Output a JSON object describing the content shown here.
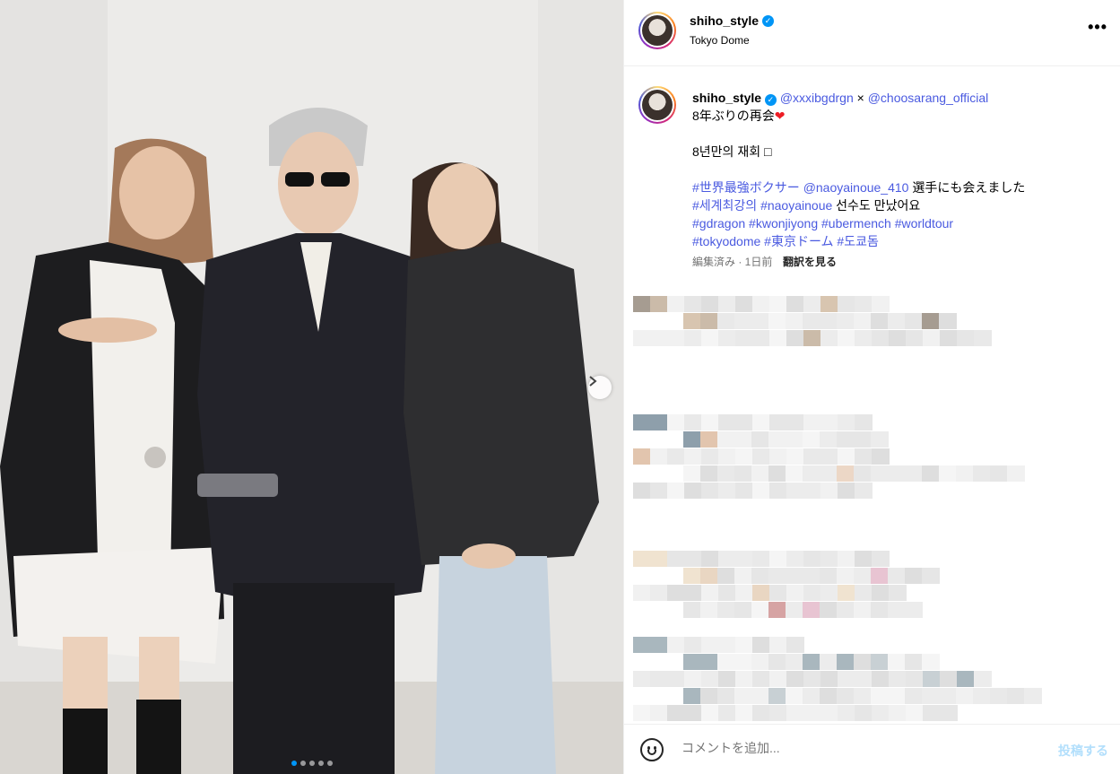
{
  "post": {
    "username": "shiho_style",
    "location": "Tokyo Dome",
    "more_label": "•••",
    "carousel": {
      "slide_count": 5,
      "active_index": 0
    }
  },
  "caption": {
    "username": "shiho_style",
    "mention_1": "@xxxibgdrgn",
    "separator": " × ",
    "mention_2": "@choosarang_official",
    "line_jp": "8年ぶりの再会",
    "heart": "❤",
    "line_kr": "8년만의 재회 ",
    "kr_box": "□",
    "hashtag_line1_tag": "#世界最強ボクサー",
    "hashtag_line1_mention": "@naoyainoue_410",
    "hashtag_line1_text": " 選手にも会えました",
    "hashtag_line2_tag1": "#세계최강의",
    "hashtag_line2_tag2": "#naoyainoue",
    "hashtag_line2_text": " 선수도 만났어요",
    "tags_line3": "#gdragon #kwonjiyong #ubermench #worldtour",
    "tags_line4": "#tokyodome #東京ドーム #도쿄돔",
    "meta_time": "編集済み · 1日前",
    "translate_label": "翻訳を見る"
  },
  "comment_bar": {
    "placeholder": "コメントを追加...",
    "post_label": "投稿する"
  },
  "colors": {
    "link": "#4a5ae0",
    "verified": "#0095f6",
    "heart": "#ed1c24"
  }
}
